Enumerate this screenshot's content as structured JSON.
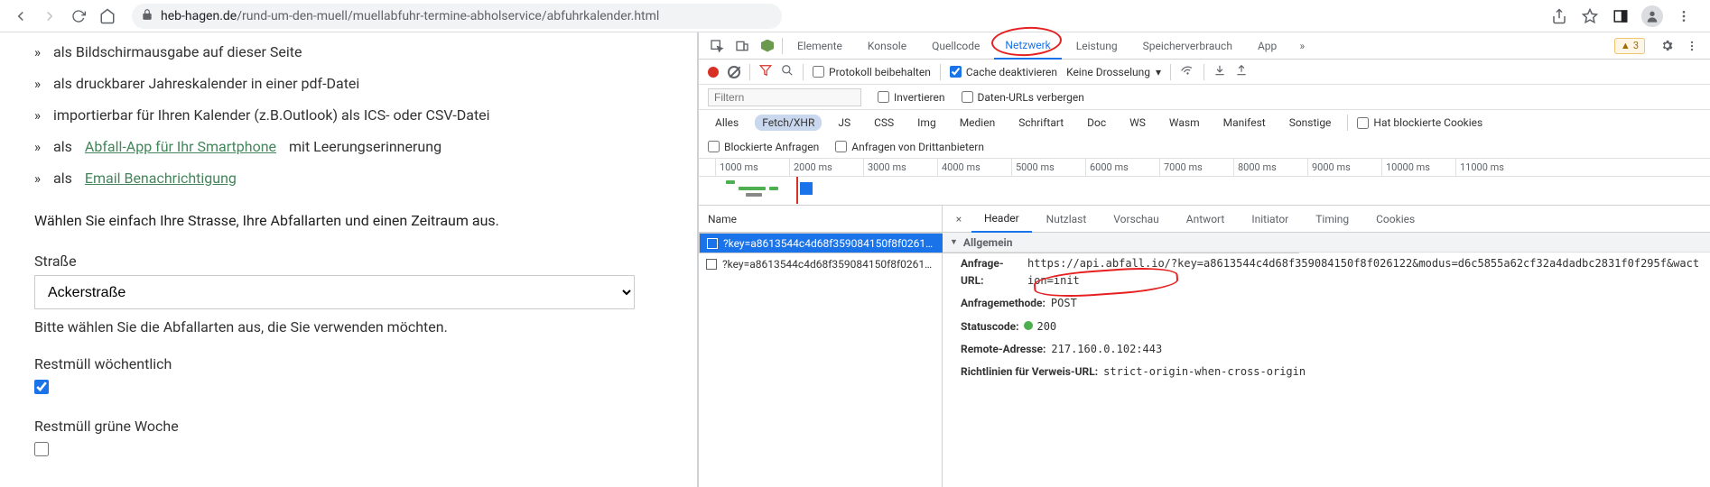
{
  "browser": {
    "url_host": "heb-hagen.de",
    "url_path": "/rund-um-den-muell/muellabfuhr-termine-abholservice/abfuhrkalender.html"
  },
  "page": {
    "bullets": {
      "b1": "als Bildschirmausgabe auf dieser Seite",
      "b2": "als druckbarer Jahreskalender in einer pdf-Datei",
      "b3": "importierbar für Ihren Kalender (z.B.Outlook) als ICS- oder CSV-Datei",
      "b4_pre": "als ",
      "b4_link": "Abfall-App für Ihr Smartphone",
      "b4_post": " mit Leerungserinnerung",
      "b5_pre": "als ",
      "b5_link": "Email Benachrichtigung"
    },
    "lead": "Wählen Sie einfach Ihre Strasse, Ihre Abfallarten und einen Zeitraum aus.",
    "street_label": "Straße",
    "street_value": "Ackerstraße",
    "hint": "Bitte wählen Sie die Abfallarten aus, die Sie verwenden möchten.",
    "chk1_label": "Restmüll wöchentlich",
    "chk2_label": "Restmüll grüne Woche"
  },
  "devtools": {
    "tabs": {
      "elements": "Elemente",
      "console": "Konsole",
      "sources": "Quellcode",
      "network": "Netzwerk",
      "performance": "Leistung",
      "memory": "Speicherverbrauch",
      "app": "App"
    },
    "warn_count": "3",
    "toolbar": {
      "preserve": "Protokoll beibehalten",
      "disable_cache": "Cache deaktivieren",
      "throttling": "Keine Drosselung"
    },
    "filter": {
      "placeholder": "Filtern",
      "invert": "Invertieren",
      "hide_data": "Daten-URLs verbergen"
    },
    "types": {
      "all": "Alles",
      "fetch": "Fetch/XHR",
      "js": "JS",
      "css": "CSS",
      "img": "Img",
      "media": "Medien",
      "font": "Schriftart",
      "doc": "Doc",
      "ws": "WS",
      "wasm": "Wasm",
      "manifest": "Manifest",
      "other": "Sonstige",
      "blocked_cookies": "Hat blockierte Cookies"
    },
    "types2": {
      "blocked_req": "Blockierte Anfragen",
      "third_party": "Anfragen von Drittanbietern"
    },
    "timeline_ticks": [
      "1000 ms",
      "2000 ms",
      "3000 ms",
      "4000 ms",
      "5000 ms",
      "6000 ms",
      "7000 ms",
      "8000 ms",
      "9000 ms",
      "10000 ms",
      "11000 ms"
    ],
    "reqlist": {
      "head": "Name",
      "r1": "?key=a8613544c4d68f359084150f8f0261…",
      "r2": "?key=a8613544c4d68f359084150f8f0261…"
    },
    "detail_tabs": {
      "headers": "Header",
      "payload": "Nutzlast",
      "preview": "Vorschau",
      "response": "Antwort",
      "initiator": "Initiator",
      "timing": "Timing",
      "cookies": "Cookies"
    },
    "general": {
      "title": "Allgemein",
      "req_url_k": "Anfrage-URL:",
      "req_url_v": "https://api.abfall.io/?key=a8613544c4d68f359084150f8f026122&modus=d6c5855a62cf32a4dadbc2831f0f295f&waction=init",
      "method_k": "Anfragemethode:",
      "method_v": "POST",
      "status_k": "Statuscode:",
      "status_v": "200",
      "remote_k": "Remote-Adresse:",
      "remote_v": "217.160.0.102:443",
      "refpol_k": "Richtlinien für Verweis-URL:",
      "refpol_v": "strict-origin-when-cross-origin"
    }
  }
}
